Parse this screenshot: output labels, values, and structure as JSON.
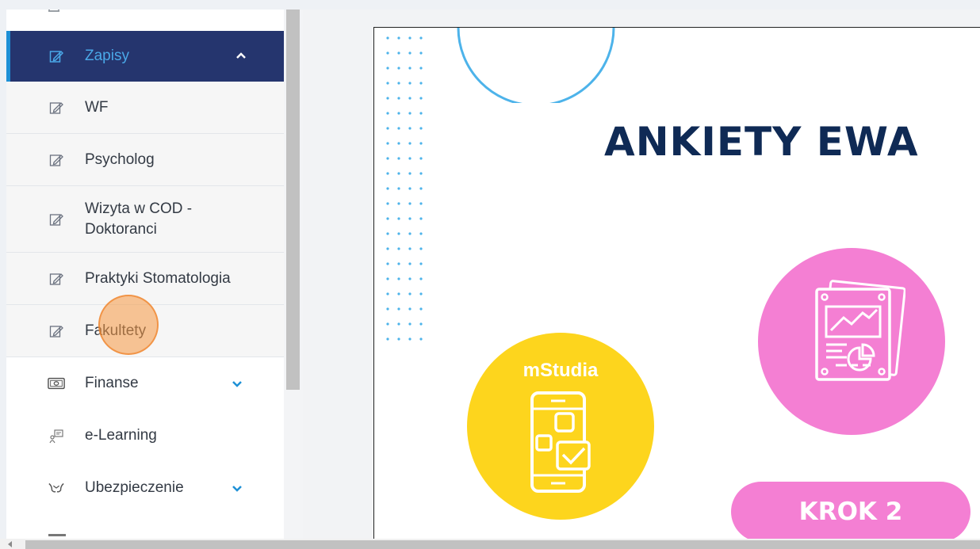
{
  "sidebar": {
    "items": [
      {
        "label": "Zapisy"
      },
      {
        "label": "WF"
      },
      {
        "label": "Psycholog"
      },
      {
        "label": "Wizyta w COD - Doktoranci"
      },
      {
        "label": "Praktyki Stomatologia"
      },
      {
        "label": "Fakultety"
      },
      {
        "label": "Finanse"
      },
      {
        "label": "e-Learning"
      },
      {
        "label": "Ubezpieczenie"
      }
    ],
    "active_color": "#25356e",
    "accent_color": "#4aa8e8"
  },
  "slide": {
    "headline": "ANKIETY EWA",
    "badge_text": "mStudia",
    "step_label": "KROK 2",
    "colors": {
      "navy": "#0f2a55",
      "yellow": "#fdd51d",
      "pink": "#f47fd3",
      "ring": "#4db3ea"
    }
  }
}
